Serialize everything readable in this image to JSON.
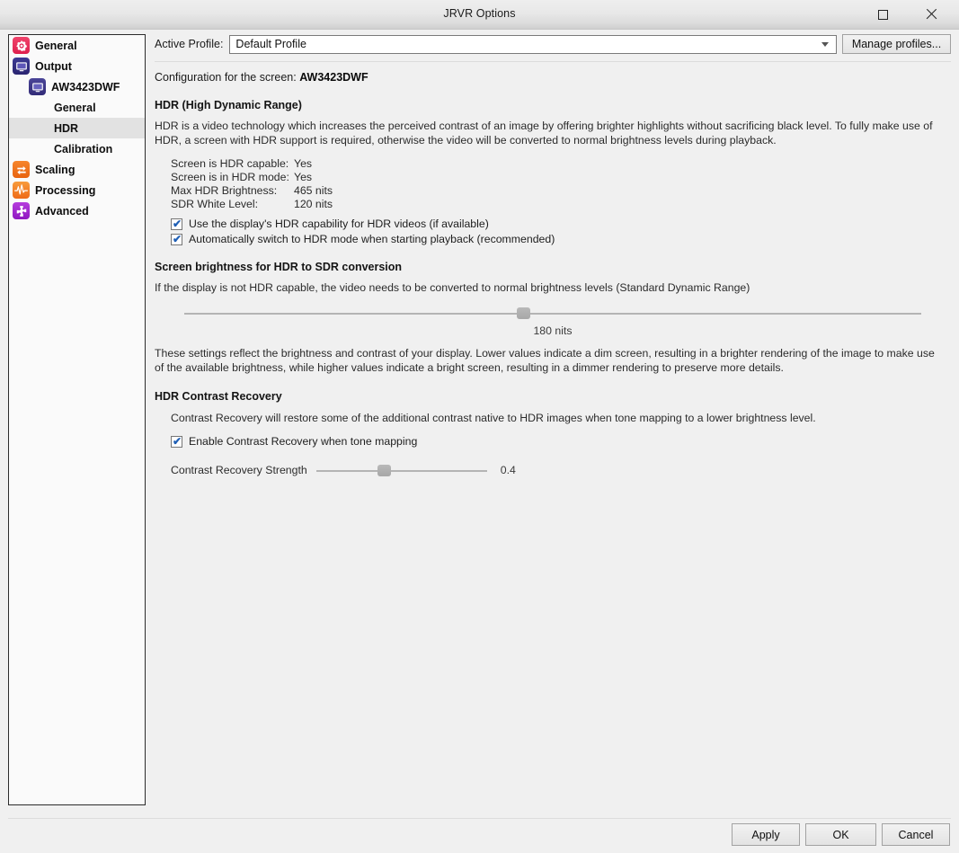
{
  "window": {
    "title": "JRVR Options",
    "maximize_icon": "maximize-icon",
    "close_icon": "close-icon"
  },
  "sidebar": {
    "items": [
      {
        "label": "General",
        "icon": "gear-icon",
        "level": 0,
        "selected": false
      },
      {
        "label": "Output",
        "icon": "monitor-icon",
        "level": 0,
        "selected": false
      },
      {
        "label": "AW3423DWF",
        "icon": "monitor-icon",
        "level": 1,
        "selected": false
      },
      {
        "label": "General",
        "icon": "none",
        "level": 2,
        "selected": false
      },
      {
        "label": "HDR",
        "icon": "none",
        "level": 2,
        "selected": true
      },
      {
        "label": "Calibration",
        "icon": "none",
        "level": 2,
        "selected": false
      },
      {
        "label": "Scaling",
        "icon": "resize-icon",
        "level": 0,
        "selected": false
      },
      {
        "label": "Processing",
        "icon": "waveform-icon",
        "level": 0,
        "selected": false
      },
      {
        "label": "Advanced",
        "icon": "puzzle-icon",
        "level": 0,
        "selected": false
      }
    ]
  },
  "profile": {
    "label": "Active Profile:",
    "selected": "Default Profile",
    "dropdown_icon": "chevron-down-icon",
    "manage_button": "Manage profiles..."
  },
  "main": {
    "config_prefix": "Configuration for the screen: ",
    "config_screen": "AW3423DWF",
    "hdr_heading": "HDR (High Dynamic Range)",
    "hdr_paragraph": "HDR is a video technology which increases the perceived contrast of an image by offering brighter highlights without sacrificing black level. To fully make use of HDR, a screen with HDR support is required, otherwise the video will be converted to normal brightness levels during playback.",
    "stats": [
      {
        "key": "Screen is HDR capable:",
        "value": "Yes"
      },
      {
        "key": "Screen is in HDR mode:",
        "value": "Yes"
      },
      {
        "key": "Max HDR Brightness:",
        "value": "465 nits"
      },
      {
        "key": "SDR White Level:",
        "value": "120 nits"
      }
    ],
    "checkbox_use_hdr": {
      "label": "Use the display's HDR capability for HDR videos (if available)",
      "checked": true,
      "mark": "✔"
    },
    "checkbox_auto_switch": {
      "label": "Automatically switch to HDR mode when starting playback (recommended)",
      "checked": true,
      "mark": "✔"
    },
    "brightness_heading": "Screen brightness for HDR to SDR conversion",
    "brightness_paragraph": "If the display is not HDR capable, the video needs to be converted to normal brightness levels (Standard Dynamic Range)",
    "brightness_value_label": "180 nits",
    "brightness_slider_percent": 46,
    "brightness_explanation": "These settings reflect the brightness and contrast of your display. Lower values indicate a dim screen, resulting in a brighter rendering of the image to make use of the available brightness, while higher values indicate a bright screen, resulting in a dimmer rendering to preserve more details.",
    "contrast_heading": "HDR Contrast Recovery",
    "contrast_paragraph": "Contrast Recovery will restore some of the additional contrast native to HDR images when tone mapping to a lower brightness level.",
    "checkbox_enable_cr": {
      "label": "Enable Contrast Recovery when tone mapping",
      "checked": true,
      "mark": "✔"
    },
    "contrast_strength_label": "Contrast Recovery Strength",
    "contrast_strength_value": "0.4",
    "contrast_slider_percent": 40
  },
  "footer": {
    "apply": "Apply",
    "ok": "OK",
    "cancel": "Cancel"
  },
  "colors": {
    "selected_nav_bg": "#e2e2e2",
    "window_bg": "#f0f0f0",
    "accent_red": "#de1f4e",
    "accent_purple": "#8f19c1",
    "accent_orange": "#e8620f",
    "check_blue": "#1f5fb5"
  }
}
